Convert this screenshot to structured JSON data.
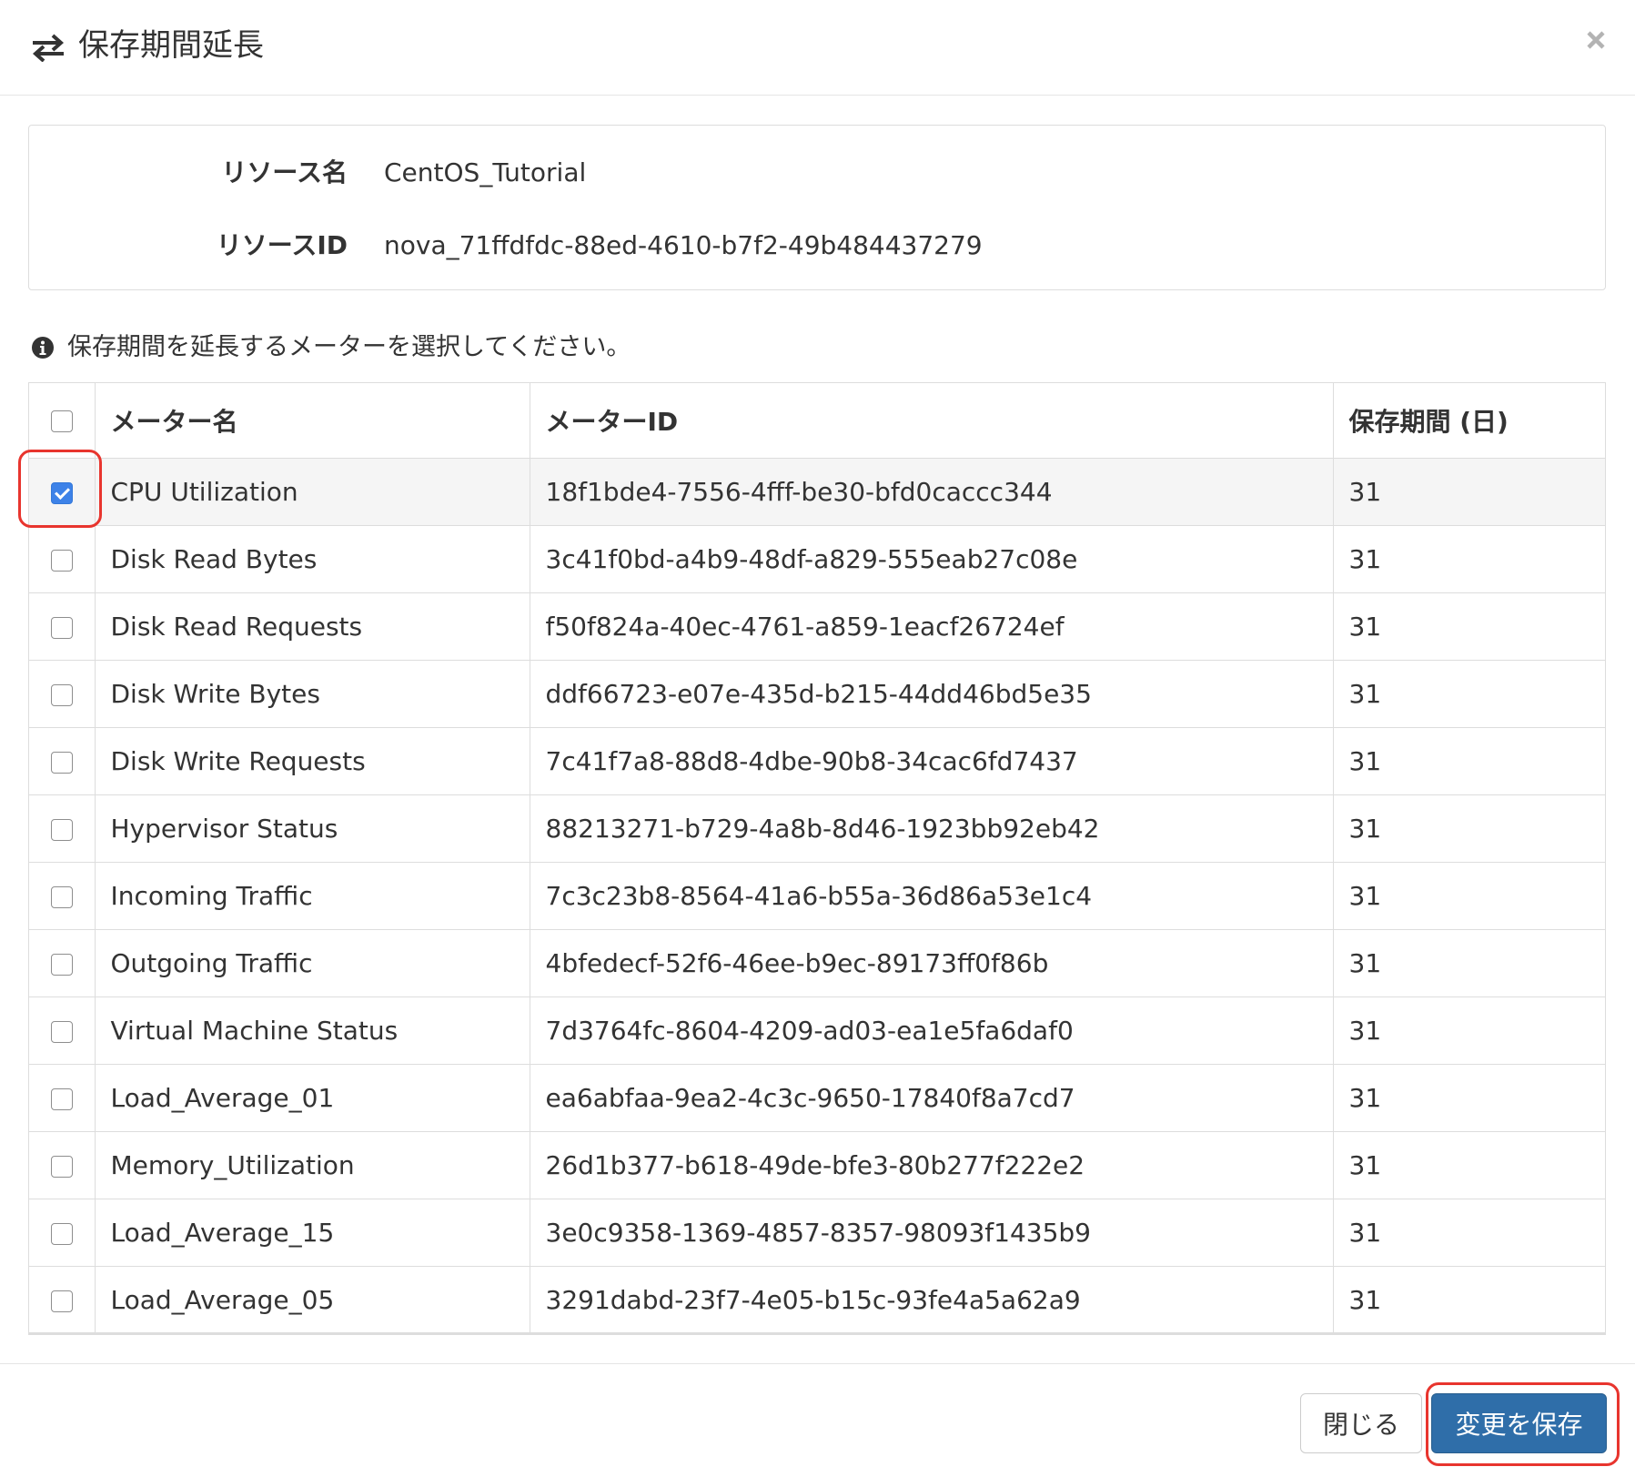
{
  "modal": {
    "title": "保存期間延長",
    "title_icon": "exchange-arrows-icon",
    "close_icon": "close-icon"
  },
  "resource": {
    "name_label": "リソース名",
    "name_value": "CentOS_Tutorial",
    "id_label": "リソースID",
    "id_value": "nova_71ffdfdc-88ed-4610-b7f2-49b484437279"
  },
  "instruction": {
    "icon": "info-circle-icon",
    "text": "保存期間を延長するメーターを選択してください。"
  },
  "table": {
    "headers": [
      "メーター名",
      "メーターID",
      "保存期間 (日)"
    ],
    "rows": [
      {
        "name": "CPU Utilization",
        "id": "18f1bde4-7556-4fff-be30-bfd0caccc344",
        "period": "31",
        "checked": true
      },
      {
        "name": "Disk Read Bytes",
        "id": "3c41f0bd-a4b9-48df-a829-555eab27c08e",
        "period": "31",
        "checked": false
      },
      {
        "name": "Disk Read Requests",
        "id": "f50f824a-40ec-4761-a859-1eacf26724ef",
        "period": "31",
        "checked": false
      },
      {
        "name": "Disk Write Bytes",
        "id": "ddf66723-e07e-435d-b215-44dd46bd5e35",
        "period": "31",
        "checked": false
      },
      {
        "name": "Disk Write Requests",
        "id": "7c41f7a8-88d8-4dbe-90b8-34cac6fd7437",
        "period": "31",
        "checked": false
      },
      {
        "name": "Hypervisor Status",
        "id": "88213271-b729-4a8b-8d46-1923bb92eb42",
        "period": "31",
        "checked": false
      },
      {
        "name": "Incoming Traffic",
        "id": "7c3c23b8-8564-41a6-b55a-36d86a53e1c4",
        "period": "31",
        "checked": false
      },
      {
        "name": "Outgoing Traffic",
        "id": "4bfedecf-52f6-46ee-b9ec-89173ff0f86b",
        "period": "31",
        "checked": false
      },
      {
        "name": "Virtual Machine Status",
        "id": "7d3764fc-8604-4209-ad03-ea1e5fa6daf0",
        "period": "31",
        "checked": false
      },
      {
        "name": "Load_Average_01",
        "id": "ea6abfaa-9ea2-4c3c-9650-17840f8a7cd7",
        "period": "31",
        "checked": false
      },
      {
        "name": "Memory_Utilization",
        "id": "26d1b377-b618-49de-bfe3-80b277f222e2",
        "period": "31",
        "checked": false
      },
      {
        "name": "Load_Average_15",
        "id": "3e0c9358-1369-4857-8357-98093f1435b9",
        "period": "31",
        "checked": false
      },
      {
        "name": "Load_Average_05",
        "id": "3291dabd-23f7-4e05-b15c-93fe4a5a62a9",
        "period": "31",
        "checked": false
      }
    ]
  },
  "footer": {
    "close_label": "閉じる",
    "save_label": "変更を保存"
  },
  "colors": {
    "primary_button": "#2f6ea9",
    "checkbox_checked": "#3d82e8",
    "highlight": "#e8352e",
    "border": "#dddddd"
  }
}
